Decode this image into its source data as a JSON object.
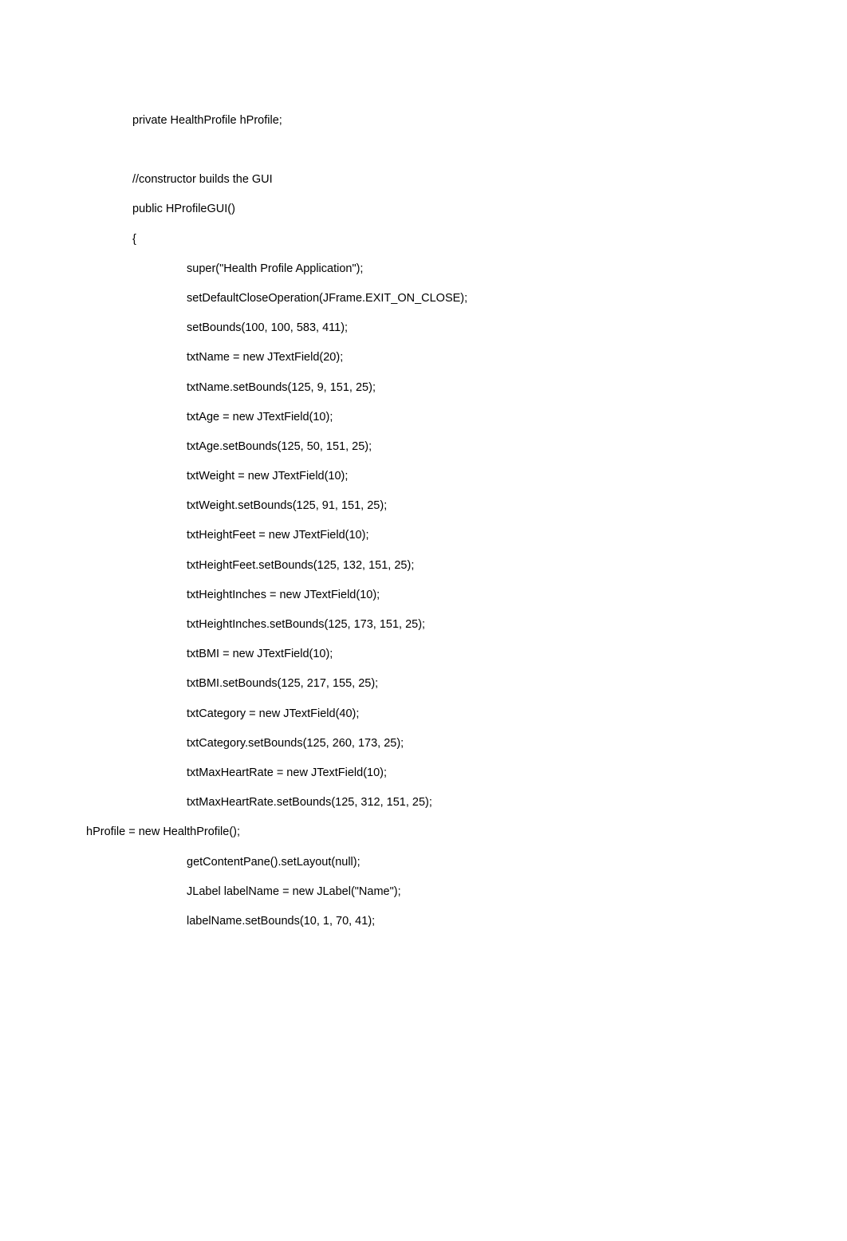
{
  "code": {
    "lines": [
      {
        "indent": "indent-1",
        "text": "private HealthProfile hProfile;"
      },
      {
        "indent": "indent-1",
        "text": ""
      },
      {
        "indent": "indent-1",
        "text": "//constructor builds the GUI"
      },
      {
        "indent": "indent-1",
        "text": "public HProfileGUI()"
      },
      {
        "indent": "indent-1",
        "text": "{"
      },
      {
        "indent": "indent-3",
        "text": "super(\"Health Profile Application\");"
      },
      {
        "indent": "indent-3",
        "text": "setDefaultCloseOperation(JFrame.EXIT_ON_CLOSE);"
      },
      {
        "indent": "indent-3",
        "text": "setBounds(100, 100, 583, 411);"
      },
      {
        "indent": "indent-3",
        "text": "txtName = new JTextField(20);"
      },
      {
        "indent": "indent-3",
        "text": "txtName.setBounds(125, 9, 151, 25);"
      },
      {
        "indent": "indent-3",
        "text": "txtAge = new JTextField(10);"
      },
      {
        "indent": "indent-3",
        "text": "txtAge.setBounds(125, 50, 151, 25);"
      },
      {
        "indent": "indent-3",
        "text": "txtWeight = new JTextField(10);"
      },
      {
        "indent": "indent-3",
        "text": "txtWeight.setBounds(125, 91, 151, 25);"
      },
      {
        "indent": "indent-3",
        "text": "txtHeightFeet = new JTextField(10);"
      },
      {
        "indent": "indent-3",
        "text": "txtHeightFeet.setBounds(125, 132, 151, 25);"
      },
      {
        "indent": "indent-3",
        "text": "txtHeightInches = new JTextField(10);"
      },
      {
        "indent": "indent-3",
        "text": "txtHeightInches.setBounds(125, 173, 151, 25);"
      },
      {
        "indent": "indent-3",
        "text": "txtBMI = new JTextField(10);"
      },
      {
        "indent": "indent-3",
        "text": "txtBMI.setBounds(125, 217, 155, 25);"
      },
      {
        "indent": "indent-3",
        "text": "txtCategory = new JTextField(40);"
      },
      {
        "indent": "indent-3",
        "text": "txtCategory.setBounds(125, 260, 173, 25);"
      },
      {
        "indent": "indent-3",
        "text": "txtMaxHeartRate = new JTextField(10);"
      },
      {
        "indent": "indent-3",
        "text": "txtMaxHeartRate.setBounds(125, 312, 151, 25);"
      },
      {
        "indent": "indent-0",
        "text": "hProfile = new HealthProfile();"
      },
      {
        "indent": "indent-3",
        "text": "getContentPane().setLayout(null);"
      },
      {
        "indent": "indent-3",
        "text": "JLabel labelName = new JLabel(\"Name\");"
      },
      {
        "indent": "indent-3",
        "text": "labelName.setBounds(10, 1, 70, 41);"
      }
    ]
  }
}
